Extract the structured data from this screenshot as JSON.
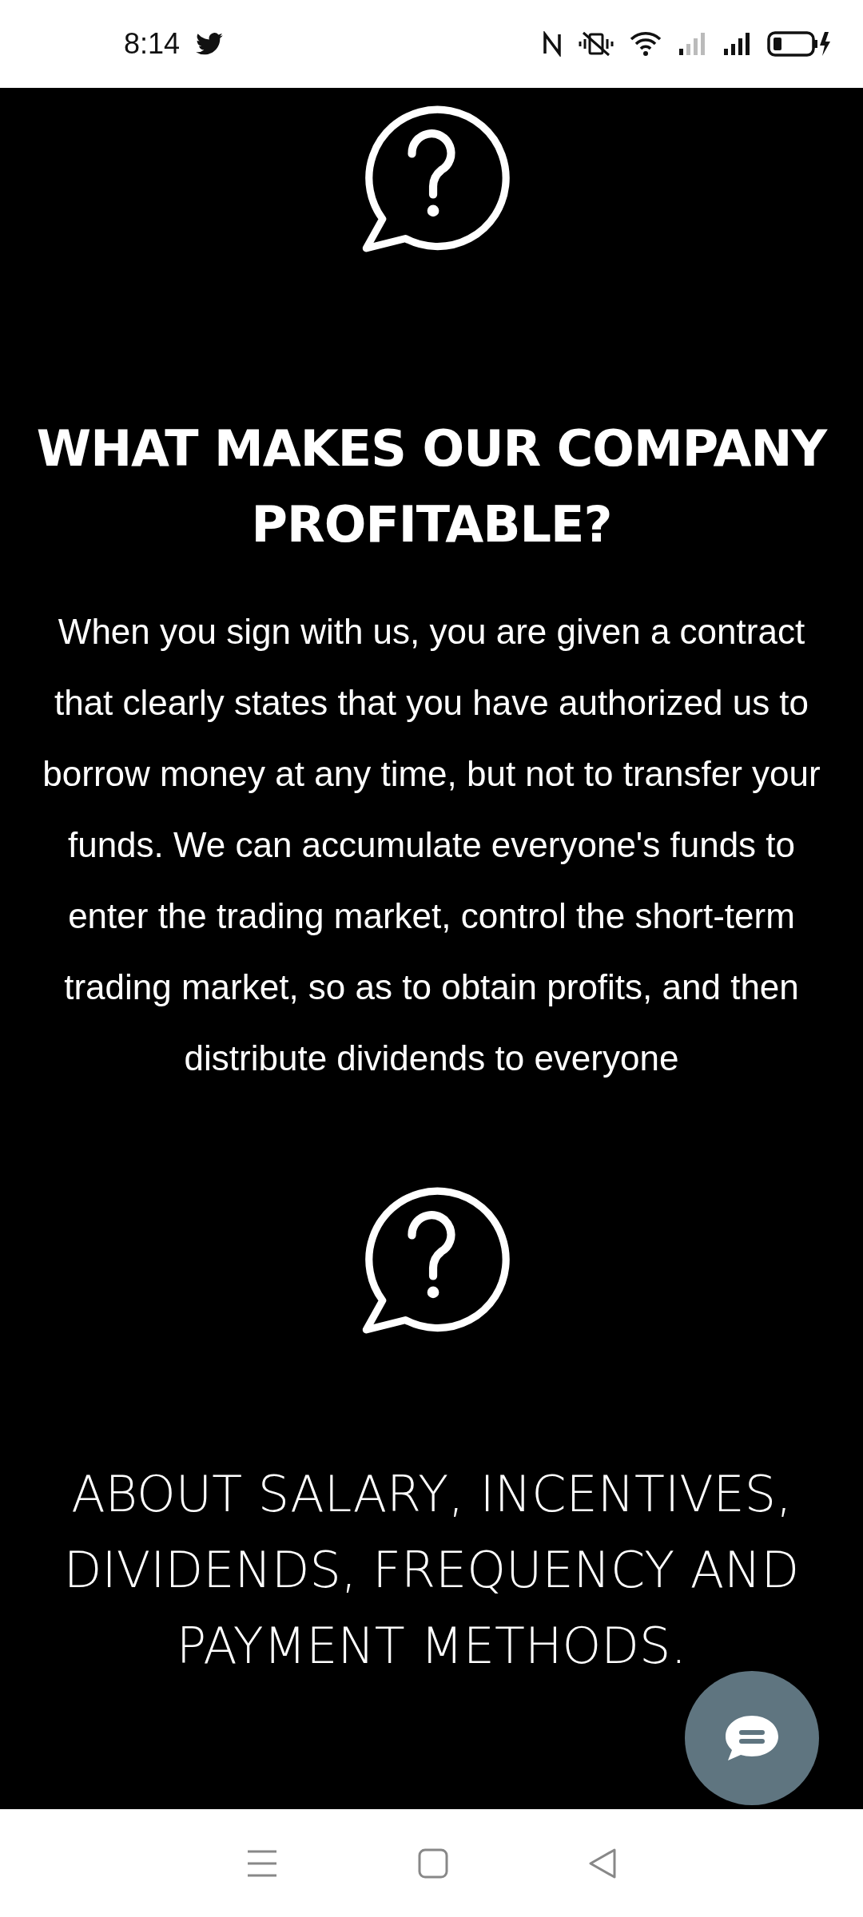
{
  "status_bar": {
    "time": "8:14"
  },
  "sections": [
    {
      "heading": "WHAT MAKES OUR COMPANY PROFITABLE?",
      "kind": "bold",
      "body": "When you sign with us, you are given a contract that clearly states that you have authorized us to borrow money at any time, but not to transfer your funds. We can accumulate everyone's funds to enter the trading market, control the short-term trading market, so as to obtain profits, and then distribute dividends to everyone"
    },
    {
      "heading": "ABOUT SALARY, INCENTIVES, DIVIDENDS, FREQUENCY AND PAYMENT METHODS.",
      "kind": "light"
    }
  ]
}
